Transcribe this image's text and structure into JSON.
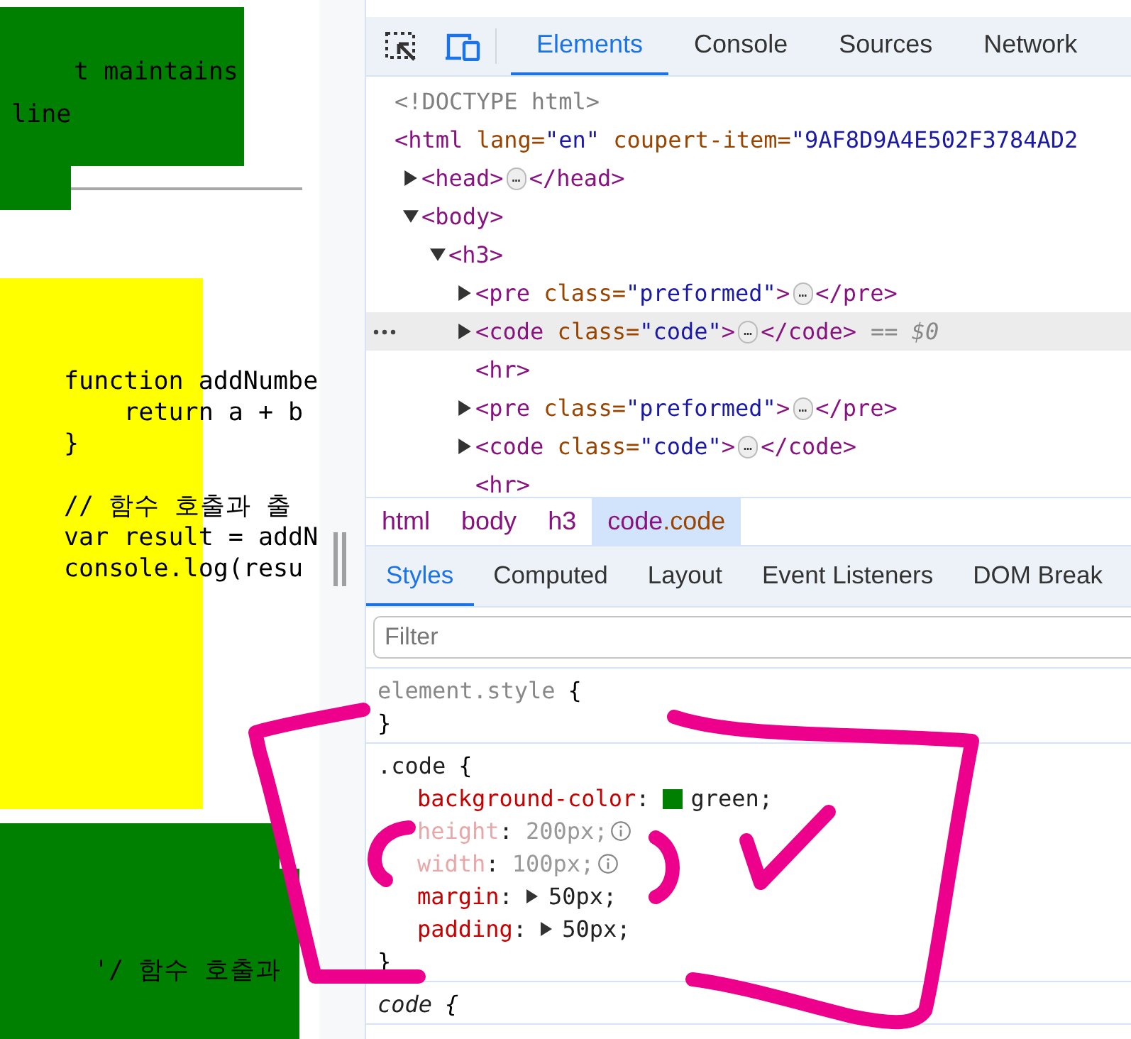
{
  "page": {
    "top_block_lines": [
      "t maintains",
      "line"
    ],
    "code_groups": [
      [
        "function addNumbe",
        "    return a + b",
        "}"
      ],
      [
        "// 함수 호출과 출",
        "var result = addN",
        "console.log(resu"
      ]
    ],
    "bottom_block_text": "'/ 함수 호출과"
  },
  "devtools": {
    "tabs": [
      {
        "label": "Elements",
        "selected": true
      },
      {
        "label": "Console",
        "selected": false
      },
      {
        "label": "Sources",
        "selected": false
      },
      {
        "label": "Network",
        "selected": false
      }
    ],
    "dom_tree": [
      {
        "tokens": [
          {
            "text": "<!DOCTYPE html>",
            "kind": "doctype"
          }
        ],
        "selected": false
      },
      {
        "tokens": [
          {
            "text": "<html",
            "kind": "tag"
          },
          {
            "text": " lang=",
            "kind": "attr"
          },
          {
            "text": "\"en\"",
            "kind": "value"
          },
          {
            "text": " coupert-item=",
            "kind": "attr"
          },
          {
            "text": "\"9AF8D9A4E502F3784AD2",
            "kind": "value"
          }
        ],
        "selected": false,
        "children": [
          {
            "tokens": [
              {
                "text": "<head>",
                "kind": "tag"
              },
              {
                "text": "…",
                "kind": "ellipsis"
              },
              {
                "text": "</head>",
                "kind": "tag"
              }
            ],
            "expanded": false,
            "selected": false
          },
          {
            "tokens": [
              {
                "text": "<body>",
                "kind": "tag"
              }
            ],
            "expanded": true,
            "selected": false,
            "children": [
              {
                "tokens": [
                  {
                    "text": "<h3>",
                    "kind": "tag"
                  }
                ],
                "expanded": true,
                "selected": false,
                "children": [
                  {
                    "tokens": [
                      {
                        "text": "<pre",
                        "kind": "tag"
                      },
                      {
                        "text": " class=",
                        "kind": "attr"
                      },
                      {
                        "text": "\"preformed\"",
                        "kind": "value"
                      },
                      {
                        "text": ">",
                        "kind": "tag"
                      },
                      {
                        "text": "…",
                        "kind": "ellipsis"
                      },
                      {
                        "text": "</pre>",
                        "kind": "tag"
                      }
                    ],
                    "expanded": false,
                    "selected": false
                  },
                  {
                    "tokens": [
                      {
                        "text": "<code",
                        "kind": "tag"
                      },
                      {
                        "text": " class=",
                        "kind": "attr"
                      },
                      {
                        "text": "\"code\"",
                        "kind": "value"
                      },
                      {
                        "text": ">",
                        "kind": "tag"
                      },
                      {
                        "text": "…",
                        "kind": "ellipsis"
                      },
                      {
                        "text": "</code>",
                        "kind": "tag"
                      },
                      {
                        "text": "== $0",
                        "kind": "hint"
                      }
                    ],
                    "expanded": false,
                    "selected": true
                  },
                  {
                    "tokens": [
                      {
                        "text": "<hr>",
                        "kind": "tag"
                      }
                    ],
                    "selected": false
                  },
                  {
                    "tokens": [
                      {
                        "text": "<pre",
                        "kind": "tag"
                      },
                      {
                        "text": " class=",
                        "kind": "attr"
                      },
                      {
                        "text": "\"preformed\"",
                        "kind": "value"
                      },
                      {
                        "text": ">",
                        "kind": "tag"
                      },
                      {
                        "text": "…",
                        "kind": "ellipsis"
                      },
                      {
                        "text": "</pre>",
                        "kind": "tag"
                      }
                    ],
                    "expanded": false,
                    "selected": false
                  },
                  {
                    "tokens": [
                      {
                        "text": "<code",
                        "kind": "tag"
                      },
                      {
                        "text": " class=",
                        "kind": "attr"
                      },
                      {
                        "text": "\"code\"",
                        "kind": "value"
                      },
                      {
                        "text": ">",
                        "kind": "tag"
                      },
                      {
                        "text": "…",
                        "kind": "ellipsis"
                      },
                      {
                        "text": "</code>",
                        "kind": "tag"
                      }
                    ],
                    "expanded": false,
                    "selected": false
                  },
                  {
                    "tokens": [
                      {
                        "text": "<hr>",
                        "kind": "tag"
                      }
                    ],
                    "selected": false
                  }
                ]
              }
            ]
          }
        ]
      }
    ],
    "breadcrumbs": [
      {
        "tag": "html",
        "selected": false
      },
      {
        "tag": "body",
        "selected": false
      },
      {
        "tag": "h3",
        "selected": false
      },
      {
        "tag": "code",
        "suffix": ".code",
        "selected": true
      }
    ],
    "style_tabs": [
      {
        "label": "Styles",
        "selected": true
      },
      {
        "label": "Computed",
        "selected": false
      },
      {
        "label": "Layout",
        "selected": false
      },
      {
        "label": "Event Listeners",
        "selected": false
      },
      {
        "label": "DOM Break",
        "selected": false
      }
    ],
    "filter": {
      "placeholder": "Filter"
    },
    "rules": [
      {
        "selector": "element.style",
        "kind": "inline",
        "open": "{",
        "close": "}"
      },
      {
        "selector": ".code",
        "kind": "author",
        "open": "{",
        "close": "}",
        "declarations": [
          {
            "property": "background-color",
            "colon": ":",
            "value": "green;",
            "color": "#008000",
            "inactive": false
          },
          {
            "property": "height",
            "colon": ":",
            "value": "200px;",
            "inactive": true,
            "info": true
          },
          {
            "property": "width",
            "colon": ":",
            "value": "100px;",
            "inactive": true,
            "info": true
          },
          {
            "property": "margin",
            "colon": ":",
            "value": "50px;",
            "inactive": false,
            "shorthand": true
          },
          {
            "property": "padding",
            "colon": ":",
            "value": "50px;",
            "inactive": false,
            "shorthand": true
          }
        ]
      },
      {
        "selector": "code",
        "kind": "useragent",
        "open": "{"
      }
    ]
  }
}
